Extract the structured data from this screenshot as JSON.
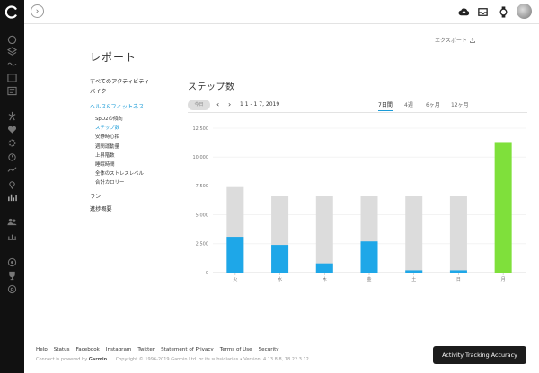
{
  "header": {
    "page_title": "レポート",
    "export_label": "エクスポート"
  },
  "nav": {
    "categories": [
      "すべてのアクティビティ",
      "バイク",
      "ヘルス&フィットネス",
      "ラン",
      "進捗概要"
    ],
    "health_items": [
      "SpO2の傾向",
      "ステップ数",
      "安静時心拍",
      "週間運動量",
      "上昇階数",
      "睡眠時間",
      "全体のストレスレベル",
      "合計カロリー"
    ],
    "active_category": "ヘルス&フィットネス",
    "active_item": "ステップ数"
  },
  "report": {
    "title": "ステップ数",
    "today_label": "今日",
    "date_range": "1 1 - 1 7, 2019",
    "periods": [
      "7日間",
      "4週",
      "6ヶ月",
      "12ヶ月"
    ],
    "active_period": "7日間"
  },
  "chart_data": {
    "type": "bar",
    "categories": [
      "火",
      "水",
      "木",
      "金",
      "土",
      "日",
      "月"
    ],
    "y_ticks": [
      "0",
      "2,500",
      "5,000",
      "7,500",
      "10,000",
      "12,500"
    ],
    "ylim": [
      0,
      12500
    ],
    "series": [
      {
        "name": "",
        "values": [
          3100,
          2400,
          800,
          2700,
          200,
          200,
          11300
        ]
      },
      {
        "name": "",
        "values": [
          7400,
          6600,
          6600,
          6600,
          6600,
          6600,
          0
        ]
      }
    ],
    "colors": {
      "steps": "#1ea7e8",
      "goal": "#dcdcdc",
      "goal_met": "#7fe03b"
    },
    "grid": true
  },
  "footer": {
    "links": [
      "Help",
      "Status",
      "Facebook",
      "Instagram",
      "Twitter",
      "Statement of Privacy",
      "Terms of Use",
      "Security"
    ],
    "powered_by": "Connect is powered by",
    "brand": "Garmin",
    "copyright": "Copyright © 1996-2019 Garmin Ltd. or its subsidiaries • Version: 4.13.8.8, 18.22.3.12",
    "accuracy_button": "Activity Tracking Accuracy"
  }
}
